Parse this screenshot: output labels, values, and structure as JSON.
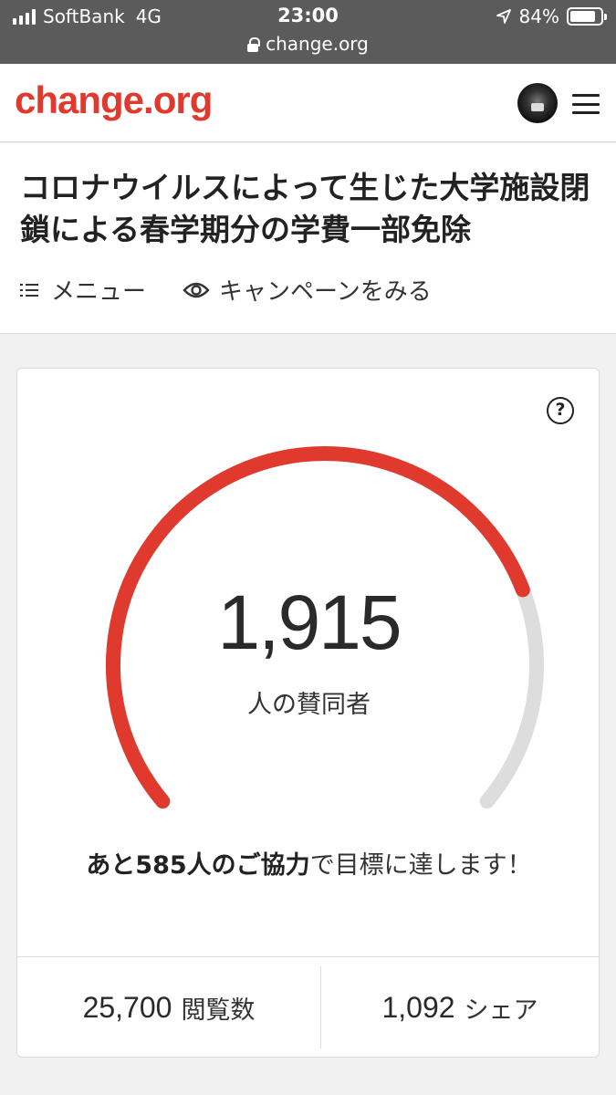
{
  "status_bar": {
    "carrier": "SoftBank",
    "network": "4G",
    "time": "23:00",
    "battery": "84%",
    "battery_level": 0.84
  },
  "url_bar": {
    "domain": "change.org"
  },
  "header": {
    "logo": "change.org"
  },
  "petition": {
    "title": "コロナウイルスによって生じた大学施設閉鎖による春学期分の学費一部免除",
    "menu_label": "メニュー",
    "campaign_label": "キャンペーンをみる"
  },
  "signatures": {
    "count": "1,915",
    "count_label": "人の賛同者",
    "progress": 0.766,
    "goal_bold": "あと585人のご協力",
    "goal_rest": "で目標に達します！",
    "help_icon_text": "?"
  },
  "stats": {
    "views_value": "25,700",
    "views_label": "閲覧数",
    "shares_value": "1,092",
    "shares_label": "シェア"
  },
  "colors": {
    "accent": "#e03a2e",
    "track": "#dddddd"
  },
  "icons": [
    "signal-icon",
    "location-arrow-icon",
    "battery-icon",
    "lock-icon",
    "avatar",
    "hamburger-menu-icon",
    "list-icon",
    "eye-icon",
    "help-icon"
  ]
}
